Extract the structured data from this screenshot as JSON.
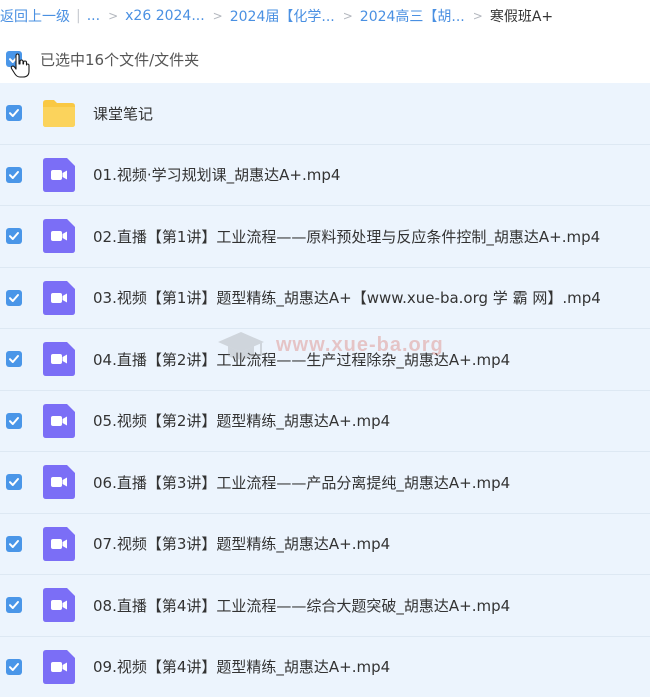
{
  "breadcrumb": {
    "back": "返回上一级",
    "ellipsis": "...",
    "crumbs": [
      "x26 2024...",
      "2024届【化学...",
      "2024高三【胡..."
    ],
    "current": "寒假班A+"
  },
  "selection": {
    "text": "已选中16个文件/文件夹",
    "checked": true
  },
  "files": [
    {
      "name": "课堂笔记",
      "type": "folder",
      "checked": true
    },
    {
      "name": "01.视频·学习规划课_胡惠达A+.mp4",
      "type": "video",
      "checked": true
    },
    {
      "name": "02.直播【第1讲】工业流程——原料预处理与反应条件控制_胡惠达A+.mp4",
      "type": "video",
      "checked": true
    },
    {
      "name": "03.视频【第1讲】题型精练_胡惠达A+【www.xue-ba.org 学 霸 网】.mp4",
      "type": "video",
      "checked": true
    },
    {
      "name": "04.直播【第2讲】工业流程——生产过程除杂_胡惠达A+.mp4",
      "type": "video",
      "checked": true
    },
    {
      "name": "05.视频【第2讲】题型精练_胡惠达A+.mp4",
      "type": "video",
      "checked": true
    },
    {
      "name": "06.直播【第3讲】工业流程——产品分离提纯_胡惠达A+.mp4",
      "type": "video",
      "checked": true
    },
    {
      "name": "07.视频【第3讲】题型精练_胡惠达A+.mp4",
      "type": "video",
      "checked": true
    },
    {
      "name": "08.直播【第4讲】工业流程——综合大题突破_胡惠达A+.mp4",
      "type": "video",
      "checked": true
    },
    {
      "name": "09.视频【第4讲】题型精练_胡惠达A+.mp4",
      "type": "video",
      "checked": true
    }
  ],
  "watermark": {
    "text": "www.xue-ba.org"
  },
  "colors": {
    "accent": "#4a90e2",
    "checkbox": "#4a96e8",
    "row_bg": "#ecf4fd",
    "folder": "#f9c843",
    "video": "#7b6ef6"
  }
}
